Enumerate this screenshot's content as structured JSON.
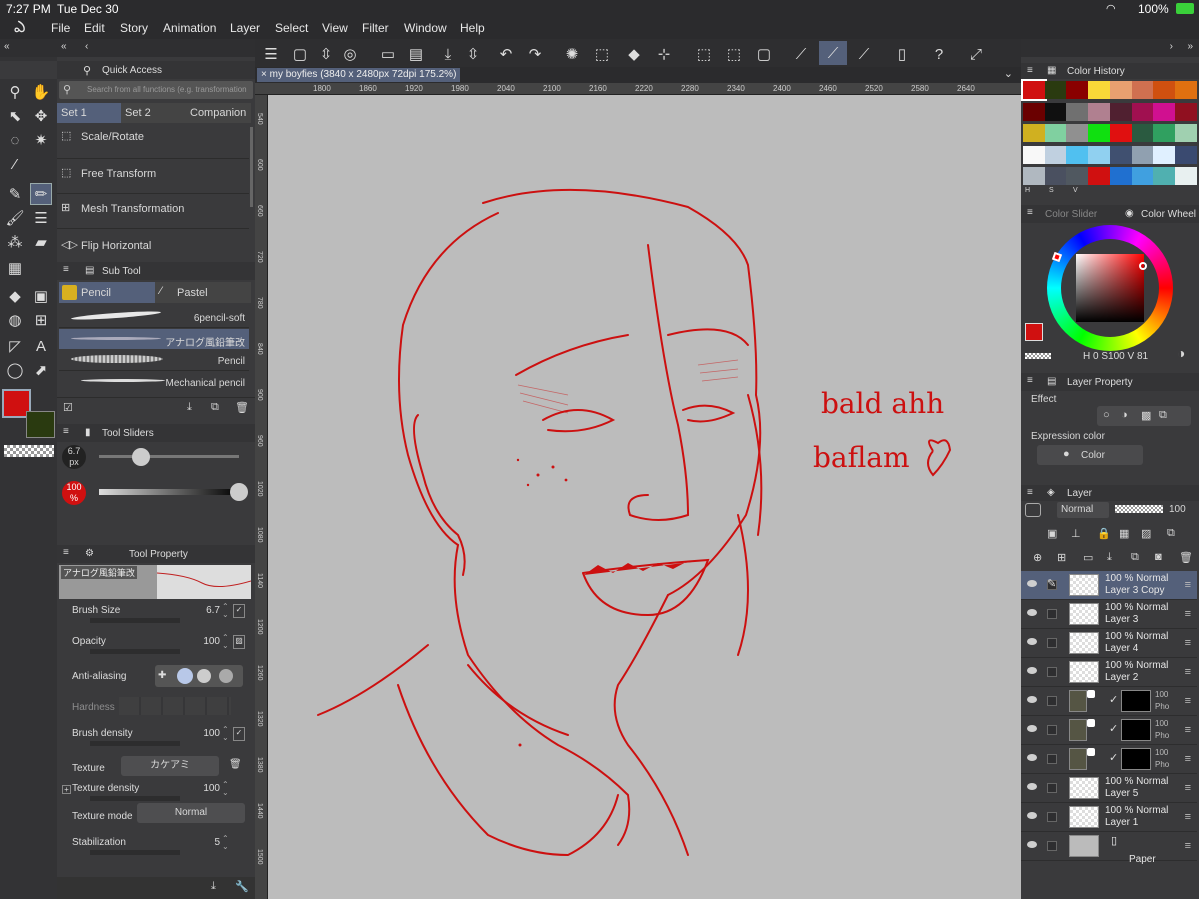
{
  "status": {
    "time": "7:27 PM",
    "date": "Tue Dec 30",
    "battery": "100%"
  },
  "menu": [
    "File",
    "Edit",
    "Story",
    "Animation",
    "Layer",
    "Select",
    "View",
    "Filter",
    "Window",
    "Help"
  ],
  "quick_access": {
    "title": "Quick Access",
    "search_placeholder": "Search from all functions (e.g. transformation, ol",
    "tabs": [
      "Set 1",
      "Set 2",
      "Companion"
    ],
    "items": [
      "Scale/Rotate",
      "Free Transform",
      "Mesh Transformation",
      "Flip Horizontal"
    ]
  },
  "sub_tool": {
    "title": "Sub Tool",
    "tabs": [
      "Pencil",
      "Pastel"
    ],
    "brushes": [
      "6pencil-soft",
      "アナログ風鉛筆改",
      "Pencil",
      "Mechanical pencil"
    ]
  },
  "tool_sliders": {
    "title": "Tool Sliders",
    "size": "6.7",
    "size_unit": "px",
    "opacity": "100",
    "opacity_unit": "%",
    "size_level": 0.3,
    "opacity_level": 1.0
  },
  "tool_property": {
    "title": "Tool Property",
    "brush_name": "アナログ風鉛筆改",
    "brush_size_label": "Brush Size",
    "brush_size": "6.7",
    "opacity_label": "Opacity",
    "opacity": "100",
    "anti_aliasing_label": "Anti-aliasing",
    "hardness_label": "Hardness",
    "brush_density_label": "Brush density",
    "brush_density": "100",
    "texture_label": "Texture",
    "texture_value": "カケアミ",
    "texture_density_label": "Texture density",
    "texture_density": "100",
    "texture_mode_label": "Texture mode",
    "texture_mode": "Normal",
    "stabilization_label": "Stabilization",
    "stabilization": "5"
  },
  "canvas": {
    "tab_title": "my boyfies (3840 x 2480px 72dpi 175.2%)",
    "ruler_top": [
      "1800",
      "1860",
      "1920",
      "1980",
      "2040",
      "2100",
      "2160",
      "2220",
      "2280",
      "2340",
      "2400",
      "2460",
      "2520",
      "2580",
      "2640"
    ],
    "ruler_left": [
      "540",
      "600",
      "660",
      "720",
      "780",
      "840",
      "900",
      "960",
      "1020",
      "1080",
      "1140",
      "1200",
      "1260",
      "1320",
      "1380",
      "1440",
      "1500"
    ],
    "annotation_line1": "bald ahh",
    "annotation_line2": "baflam"
  },
  "color_history": {
    "title": "Color History",
    "colors": [
      "#d01010",
      "#2a3a10",
      "#8a0000",
      "#f8d838",
      "#e8a070",
      "#d07050",
      "#d05010",
      "#e07010",
      "#6a0000",
      "#101010",
      "#707070",
      "#b08090",
      "#502030",
      "#a01050",
      "#d01090",
      "#901020",
      "#d0b020",
      "#80d0a0",
      "#909090",
      "#10e010",
      "#e01010",
      "#2a5a40",
      "#30a060",
      "#a0d0b0",
      "#f8f8f8",
      "#c0d0e0",
      "#50c0f0",
      "#90d0f0",
      "#405070",
      "#90a0b0",
      "#e0f0ff",
      "#3a4a70",
      "#b0b8c0",
      "#4a5060",
      "#505860",
      "#d01010",
      "#2070d0",
      "#40a0e0",
      "#50b0b0",
      "#e8f0f0"
    ],
    "labels": [
      "H",
      "S",
      "V"
    ]
  },
  "color_wheel": {
    "tab1": "Color Slider",
    "tab2": "Color Wheel",
    "h": "0",
    "s": "100",
    "v": "81",
    "labels": [
      "H",
      "S",
      "V"
    ]
  },
  "layer_property": {
    "title": "Layer Property",
    "effect": "Effect",
    "expression_label": "Expression color",
    "expression_value": "Color"
  },
  "layer_panel": {
    "title": "Layer",
    "blend": "Normal",
    "opacity": "100"
  },
  "layers": [
    {
      "pct": "100 %",
      "mode": "Normal",
      "name": "Layer 3 Copy",
      "selected": true
    },
    {
      "pct": "100 %",
      "mode": "Normal",
      "name": "Layer 3"
    },
    {
      "pct": "100 %",
      "mode": "Normal",
      "name": "Layer 4"
    },
    {
      "pct": "100 %",
      "mode": "Normal",
      "name": "Layer 2"
    },
    {
      "pct": "100",
      "mode": "",
      "name": "Pho",
      "photo": true
    },
    {
      "pct": "100",
      "mode": "",
      "name": "Pho",
      "photo": true
    },
    {
      "pct": "100",
      "mode": "",
      "name": "Pho",
      "photo": true
    },
    {
      "pct": "100 %",
      "mode": "Normal",
      "name": "Layer 5"
    },
    {
      "pct": "100 %",
      "mode": "Normal",
      "name": "Layer 1"
    },
    {
      "pct": "",
      "mode": "",
      "name": "Paper",
      "paper": true
    }
  ],
  "accent": "#d01010"
}
